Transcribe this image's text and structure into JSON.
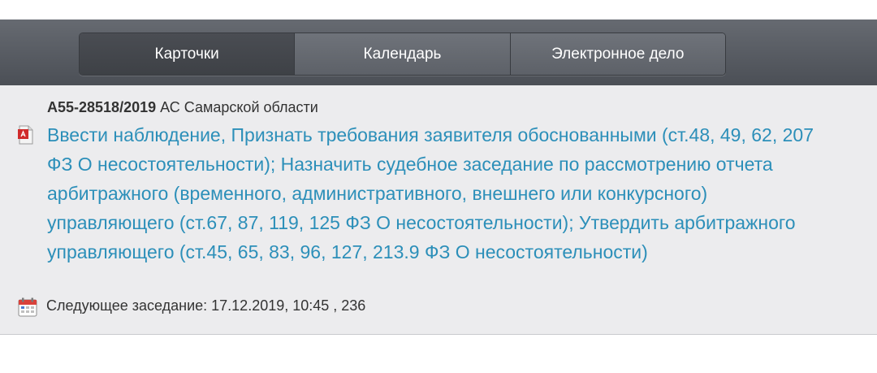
{
  "tabs": [
    {
      "label": "Карточки",
      "active": true
    },
    {
      "label": "Календарь",
      "active": false
    },
    {
      "label": "Электронное дело",
      "active": false
    }
  ],
  "case": {
    "number": "А55-28518/2019",
    "court": "АС Самарской области",
    "description": "Ввести наблюдение, Признать требования заявителя обоснованными (ст.48, 49, 62, 207 ФЗ О несостоятельности); Назначить судебное заседание по рассмотрению отчета арбитражного (временного, административного, внешнего или конкурсного) управляющего (ст.67, 87, 119, 125 ФЗ О несостоятельности); Утвердить арбитражного управляющего (ст.45, 65, 83, 96, 127, 213.9 ФЗ О несостоятельности)",
    "next_session": "Следующее заседание: 17.12.2019, 10:45 , 236"
  },
  "icons": {
    "document": "pdf-icon",
    "calendar": "calendar-icon"
  },
  "colors": {
    "link": "#2c8fb9",
    "tabbar": "#5a5e65",
    "card_bg": "#ececee",
    "pdf_red": "#d02a2a"
  }
}
